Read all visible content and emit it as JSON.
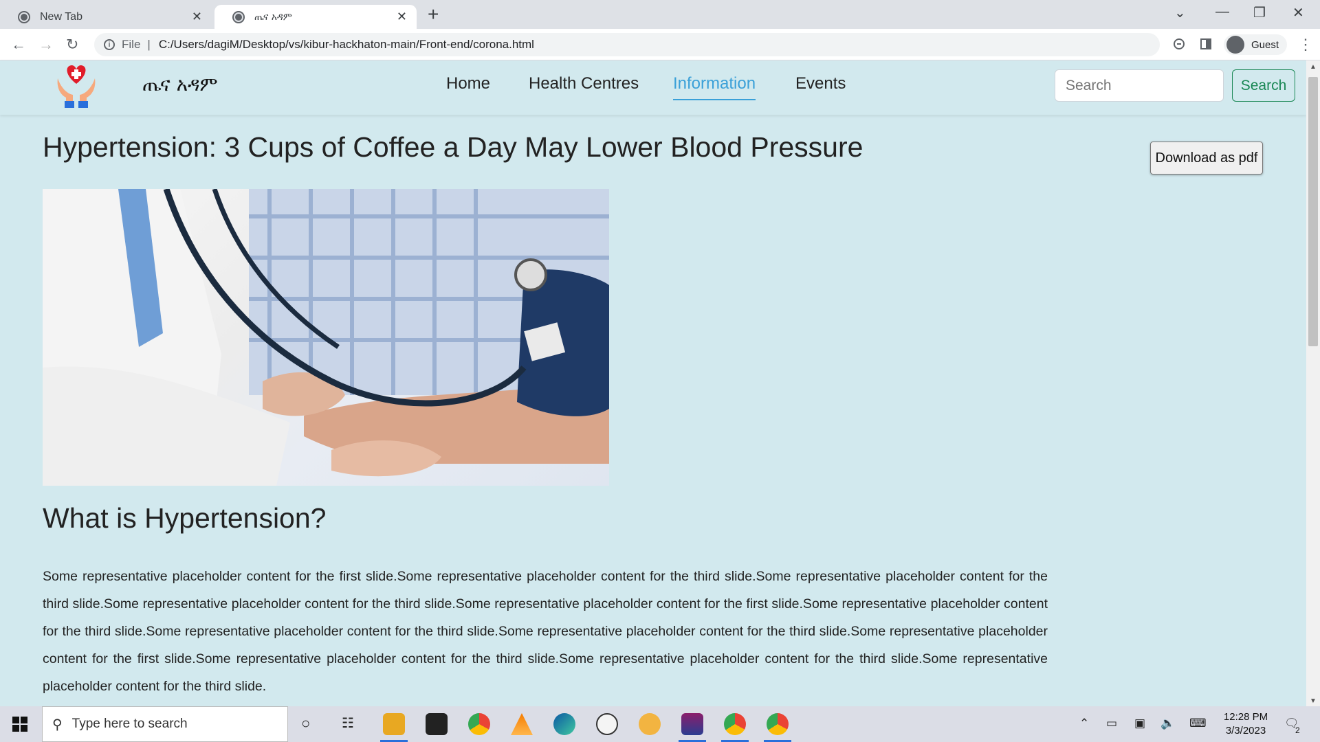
{
  "browser": {
    "tabs": [
      {
        "label": "New Tab"
      },
      {
        "label": "ጤና አዳም"
      }
    ],
    "address": {
      "scheme_label": "File",
      "url": "C:/Users/dagiM/Desktop/vs/kibur-hackhaton-main/Front-end/corona.html"
    },
    "profile_label": "Guest"
  },
  "site": {
    "brand": "ጤና አዳም",
    "nav": [
      {
        "label": "Home"
      },
      {
        "label": "Health Centres"
      },
      {
        "label": "Information",
        "active": true
      },
      {
        "label": "Events"
      }
    ],
    "search_placeholder": "Search",
    "search_button": "Search"
  },
  "article": {
    "title": "Hypertension: 3 Cups of Coffee a Day May Lower Blood Pressure",
    "download_button": "Download as pdf",
    "subtitle": "What is Hypertension?",
    "body": "Some representative placeholder content for the first slide.Some representative placeholder content for the third slide.Some representative placeholder content for the third slide.Some representative placeholder content for the third slide.Some representative placeholder content for the first slide.Some representative placeholder content for the third slide.Some representative placeholder content for the third slide.Some representative placeholder content for the third slide.Some representative placeholder content for the first slide.Some representative placeholder content for the third slide.Some representative placeholder content for the third slide.Some representative placeholder content for the third slide."
  },
  "taskbar": {
    "search_placeholder": "Type here to search",
    "time": "12:28 PM",
    "date": "3/3/2023",
    "notification_count": "2"
  },
  "colors": {
    "page_bg": "#d2e9ee",
    "nav_active": "#3aa0d8",
    "search_button": "#198754"
  }
}
